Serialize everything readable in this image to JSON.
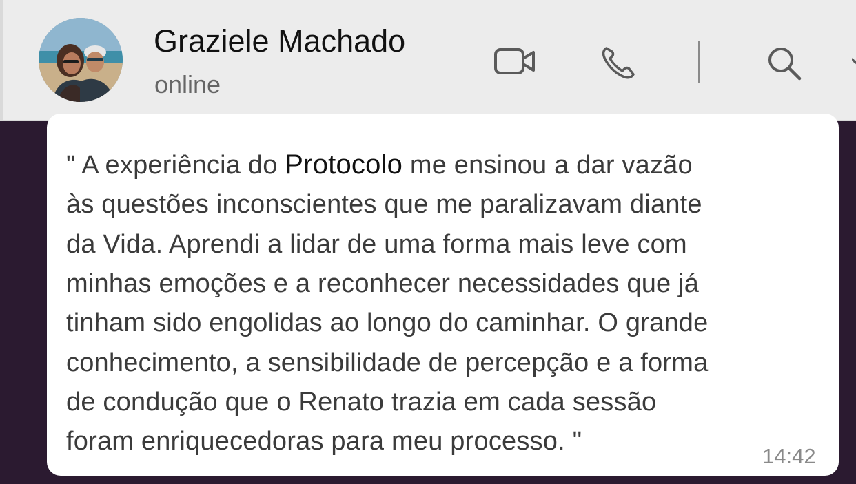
{
  "header": {
    "contact_name": "Graziele Machado",
    "status": "online",
    "icons": [
      "video-call-icon",
      "phone-call-icon",
      "search-icon",
      "chevron-down-icon"
    ]
  },
  "message": {
    "line1_part1": "\" A experiência do ",
    "line1_highlight": "Protocolo",
    "line1_part2": "  me ensinou a  dar vazão",
    "lines": [
      "às questões inconscientes que me paralizavam diante",
      "da Vida. Aprendi a lidar de uma forma mais leve com",
      "minhas emoções e a reconhecer necessidades que já",
      "tinham sido engolidas ao longo do caminhar. O grande",
      "conhecimento, a sensibilidade de percepção e a forma",
      "de condução que o Renato trazia em cada sessão",
      "foram enriquecedoras para meu processo. \""
    ],
    "time": "14:42"
  },
  "colors": {
    "header_bg": "#ececec",
    "chat_bg": "#2b1a30",
    "bubble_bg": "#ffffff",
    "text": "#3b3b3b",
    "muted": "#666666"
  }
}
